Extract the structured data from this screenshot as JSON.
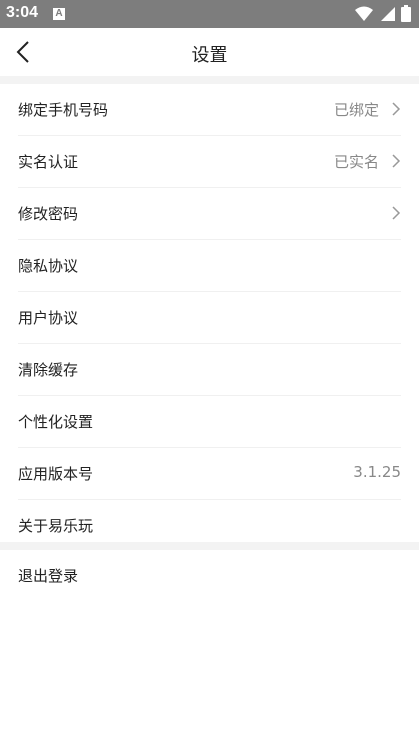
{
  "status_bar": {
    "time": "3:04",
    "notification_icon": "A"
  },
  "header": {
    "title": "设置",
    "back_icon": "chevron-left-icon"
  },
  "settings": {
    "items": [
      {
        "label": "绑定手机号码",
        "value": "已绑定",
        "has_arrow": true
      },
      {
        "label": "实名认证",
        "value": "已实名",
        "has_arrow": true
      },
      {
        "label": "修改密码",
        "value": "",
        "has_arrow": true
      },
      {
        "label": "隐私协议",
        "value": "",
        "has_arrow": false
      },
      {
        "label": "用户协议",
        "value": "",
        "has_arrow": false
      },
      {
        "label": "清除缓存",
        "value": "",
        "has_arrow": false
      },
      {
        "label": "个性化设置",
        "value": "",
        "has_arrow": false
      },
      {
        "label": "应用版本号",
        "value": "3.1.25",
        "has_arrow": false
      },
      {
        "label": "关于易乐玩",
        "value": "",
        "has_arrow": false
      }
    ]
  },
  "logout": {
    "label": "退出登录"
  },
  "colors": {
    "status_bar": "#7d7d7d",
    "divider": "#f3f3f3",
    "text": "#222222",
    "secondary_text": "#888888"
  }
}
